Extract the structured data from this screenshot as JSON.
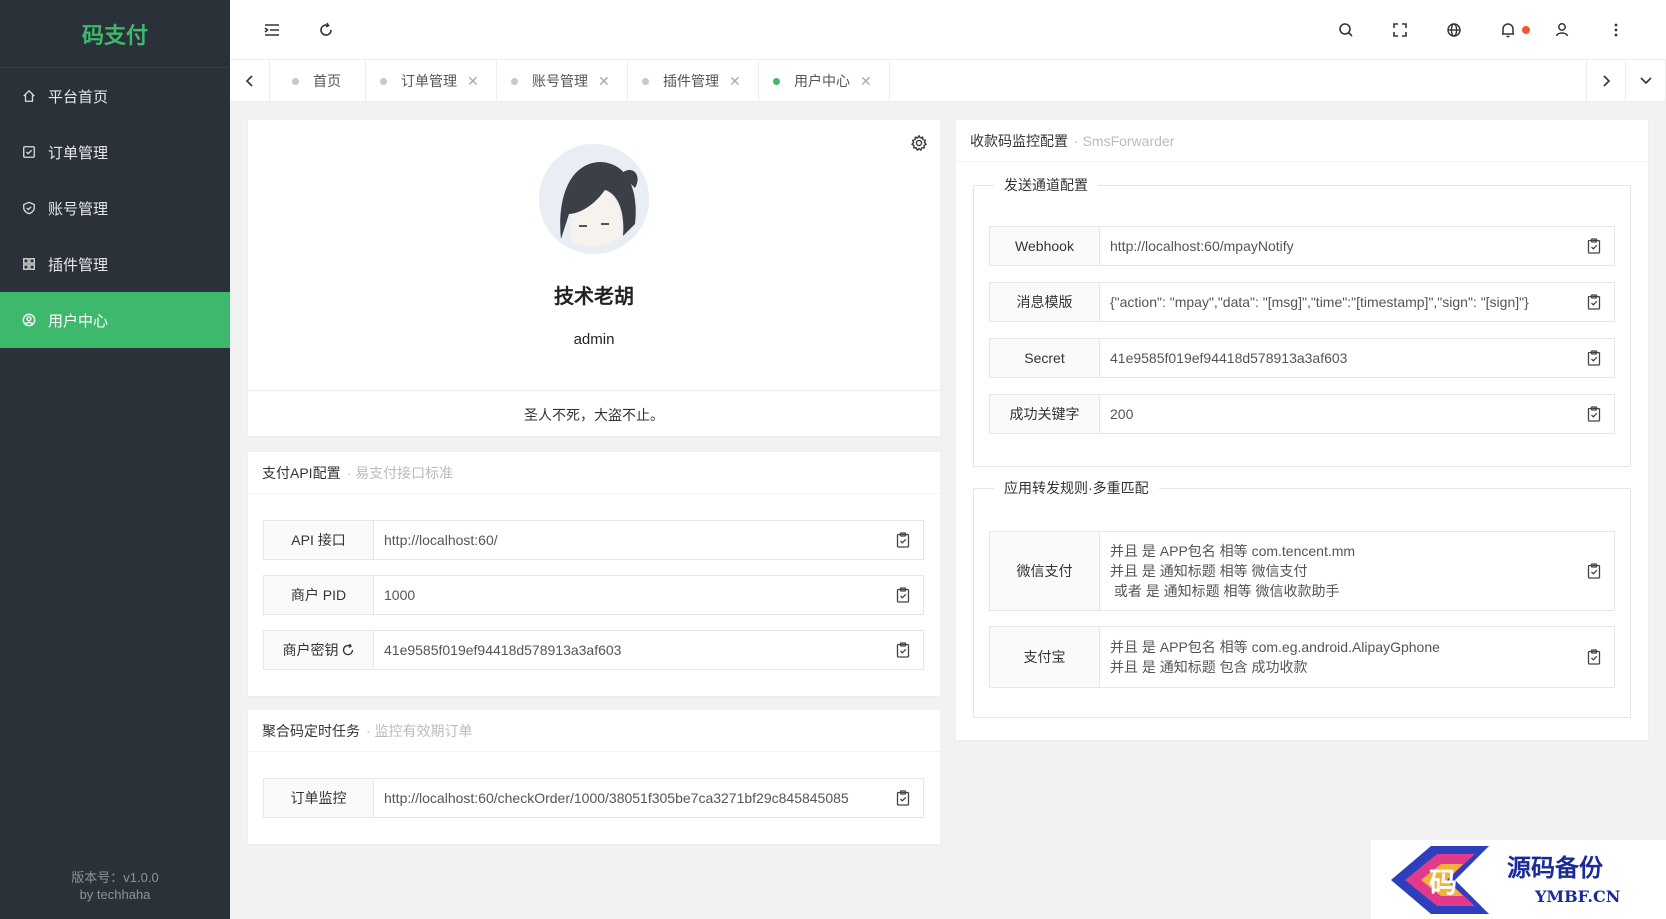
{
  "sidebar": {
    "logo": "码支付",
    "items": [
      {
        "label": "平台首页",
        "icon": "home-icon",
        "active": false
      },
      {
        "label": "订单管理",
        "icon": "check-square-icon",
        "active": false
      },
      {
        "label": "账号管理",
        "icon": "shield-icon",
        "active": false
      },
      {
        "label": "插件管理",
        "icon": "grid-icon",
        "active": false
      },
      {
        "label": "用户中心",
        "icon": "user-circle-icon",
        "active": true
      }
    ],
    "version_line1": "版本号：v1.0.0",
    "version_line2": "by techhaha"
  },
  "tabs": [
    {
      "label": "首页",
      "closable": false,
      "active": false
    },
    {
      "label": "订单管理",
      "closable": true,
      "active": false
    },
    {
      "label": "账号管理",
      "closable": true,
      "active": false
    },
    {
      "label": "插件管理",
      "closable": true,
      "active": false
    },
    {
      "label": "用户中心",
      "closable": true,
      "active": true
    }
  ],
  "profile": {
    "name": "技术老胡",
    "username": "admin",
    "motto": "圣人不死，大盗不止。"
  },
  "api_config": {
    "title": "支付API配置",
    "subtitle": "易支付接口标准",
    "rows": [
      {
        "label": "API 接口",
        "value": "http://localhost:60/"
      },
      {
        "label": "商户 PID",
        "value": "1000"
      },
      {
        "label": "商户密钥",
        "value": "41e9585f019ef94418d578913a3af603"
      }
    ]
  },
  "cron": {
    "title": "聚合码定时任务",
    "subtitle": "监控有效期订单",
    "rows": [
      {
        "label": "订单监控",
        "value": "http://localhost:60/checkOrder/1000/38051f305be7ca3271bf29c845845085"
      }
    ]
  },
  "monitor": {
    "title": "收款码监控配置",
    "subtitle": "SmsForwarder",
    "send_legend": "发送通道配置",
    "send_rows": [
      {
        "label": "Webhook",
        "value": "http://localhost:60/mpayNotify"
      },
      {
        "label": "消息模版",
        "value": "{\"action\": \"mpay\",\"data\": \"[msg]\",\"time\":\"[timestamp]\",\"sign\": \"[sign]\"}"
      },
      {
        "label": "Secret",
        "value": "41e9585f019ef94418d578913a3af603"
      },
      {
        "label": "成功关键字",
        "value": "200"
      }
    ],
    "rules_legend": "应用转发规则·多重匹配",
    "rules": [
      {
        "label": "微信支付",
        "lines": [
          "并且 是 APP包名 相等 com.tencent.mm",
          "并且 是 通知标题 相等 微信支付",
          " 或者 是 通知标题 相等 微信收款助手"
        ]
      },
      {
        "label": "支付宝",
        "lines": [
          "并且 是 APP包名 相等 com.eg.android.AlipayGphone",
          "并且 是 通知标题 包含 成功收款"
        ]
      }
    ]
  },
  "watermark": {
    "cn": "源码备份",
    "en": "YMBF.CN",
    "glyph": "码"
  },
  "colors": {
    "accent": "#3eb96b",
    "sidebar_bg": "#2a3139",
    "notify_dot": "#f0572f"
  }
}
